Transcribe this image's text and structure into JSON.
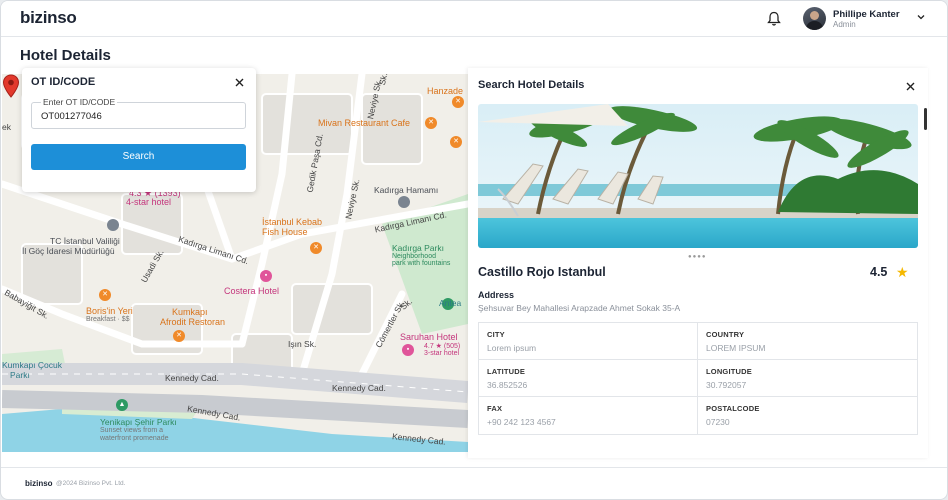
{
  "app": {
    "logo": "bizinso"
  },
  "header": {
    "user_name": "Phillipe Kanter",
    "user_role": "Admin",
    "bell_icon": "bell-icon",
    "chevron_icon": "chevron-down-icon"
  },
  "page": {
    "title": "Hotel Details"
  },
  "search_card": {
    "title": "OT ID/CODE",
    "field_label": "Enter OT ID/CODE",
    "field_value": "OT001277046",
    "button_label": "Search"
  },
  "map": {
    "labels": {
      "hanzade": "Hanzade",
      "mivan": "Mivan Restaurant Cafe",
      "kadirga_hamami": "Kadırga Hamamı",
      "istanbul_kebab_1": "İstanbul Kebab",
      "istanbul_kebab_2": "Fish House",
      "kadirga_limani_cd_top": "Kadırga Limanı Cd.",
      "kadirga_limani_cd": "Kadırga Limanı Cd.",
      "kadirga_parki": "Kadırga Parkı",
      "neighborhood_park_1": "Neighborhood",
      "neighborhood_park_2": "park with fountains",
      "tc_istanbul_1": "TC İstanbul Valiliği",
      "tc_istanbul_2": "İl Göç İdaresi Müdürlüğü",
      "costera": "Costera Hotel",
      "boris_1": "Boris'in Yeri",
      "boris_2": "Breakfast · $$",
      "kumkapi_1": "Kumkapı",
      "kumkapi_2": "Afrodit Restoran",
      "antea": "Antea",
      "saruhan_1": "Saruhan Hotel",
      "saruhan_2": "4.7 ★ (505)",
      "saruhan_3": "3-star hotel",
      "hotel_rating": "4.3 ★ (1393)",
      "hotel_stars": "4-star hotel",
      "cocuk_1": "Kumkapı Çocuk",
      "cocuk_2": "Parkı",
      "kennedy_1": "Kennedy Cad.",
      "kennedy_2": "Kennedy Cad.",
      "kennedy_3": "Kennedy Cad.",
      "kennedy_4": "Kennedy Cad.",
      "yenikapi_1": "Yenikapı Şehir Parkı",
      "yenikapi_2": "Sunset views from a",
      "yenikapi_3": "waterfront promenade",
      "isin_sk": "Işın Sk.",
      "gedik_pasa": "Gedik Paşa Cd.",
      "neviye_sk_1": "Neviye Sk.",
      "neviye_sk_2": "Neviye Sk.",
      "babayigit": "Babayiğit Sk.",
      "usadi_sk": "Usadi Sk.",
      "comertler": "Cömertler Sk.",
      "sk_1": "Sk.",
      "sk_2": "ek",
      "sk_3": "Sk."
    }
  },
  "details": {
    "title": "Search Hotel Details",
    "hotel_name": "Castillo Rojo Istanbul",
    "rating": "4.5",
    "address_label": "Address",
    "address_value": "Şehsuvar Bey Mahallesi Arapzade Ahmet Sokak 35-A",
    "fields": [
      {
        "label": "CITY",
        "value": "Lorem ipsum"
      },
      {
        "label": "COUNTRY",
        "value": "LOREM IPSUM"
      },
      {
        "label": "LATITUDE",
        "value": "36.852526"
      },
      {
        "label": "LONGITUDE",
        "value": "30.792057"
      },
      {
        "label": "FAX",
        "value": "+90 242 123 4567"
      },
      {
        "label": "POSTALCODE",
        "value": "07230"
      }
    ]
  },
  "footer": {
    "logo": "bizinso",
    "copyright": "@2024 Bizinso Pvt. Ltd."
  }
}
